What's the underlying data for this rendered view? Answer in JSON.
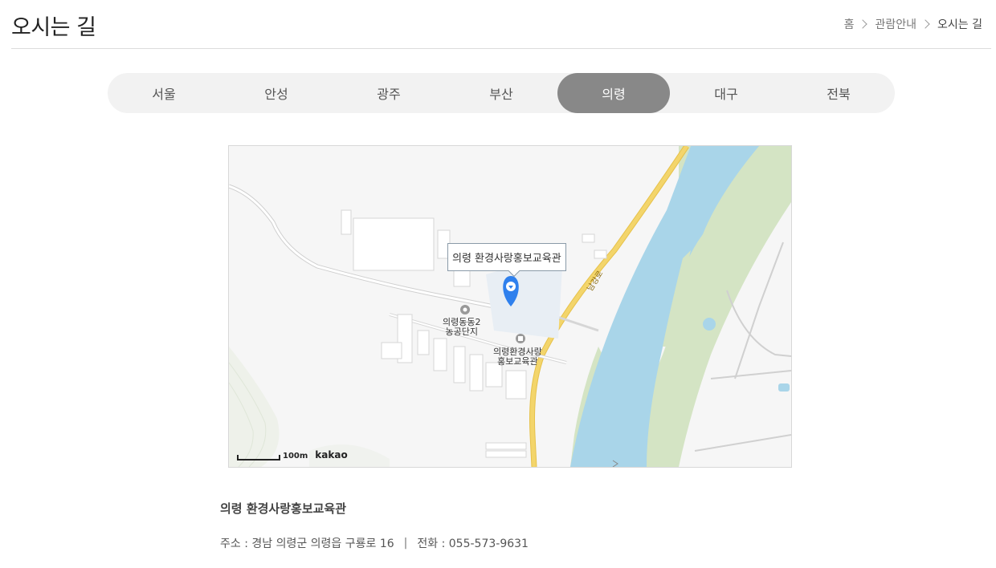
{
  "header": {
    "title": "오시는 길",
    "breadcrumb": [
      "홈",
      "관람안내",
      "오시는 길"
    ]
  },
  "tabs": [
    {
      "label": "서울",
      "active": false
    },
    {
      "label": "안성",
      "active": false
    },
    {
      "label": "광주",
      "active": false
    },
    {
      "label": "부산",
      "active": false
    },
    {
      "label": "의령",
      "active": true
    },
    {
      "label": "대구",
      "active": false
    },
    {
      "label": "전북",
      "active": false
    }
  ],
  "map": {
    "info_window": "의령 환경사랑홍보교육관",
    "poi_1": [
      "의령동동2",
      "농공단지"
    ],
    "poi_2": [
      "의령환경사랑",
      "홍보교육관"
    ],
    "road_name": "남강로",
    "scale_text": "100m",
    "brand": "kakao",
    "colors": {
      "water": "#a9d5e9",
      "green": "#d4e4c4",
      "road": "#f3d56b",
      "building_area": "#e8eef4"
    }
  },
  "place": {
    "name": "의령 환경사랑홍보교육관",
    "address": "주소 : 경남 의령군 의령읍 구룡로 16",
    "divider": "|",
    "phone": "전화 : 055-573-9631"
  }
}
